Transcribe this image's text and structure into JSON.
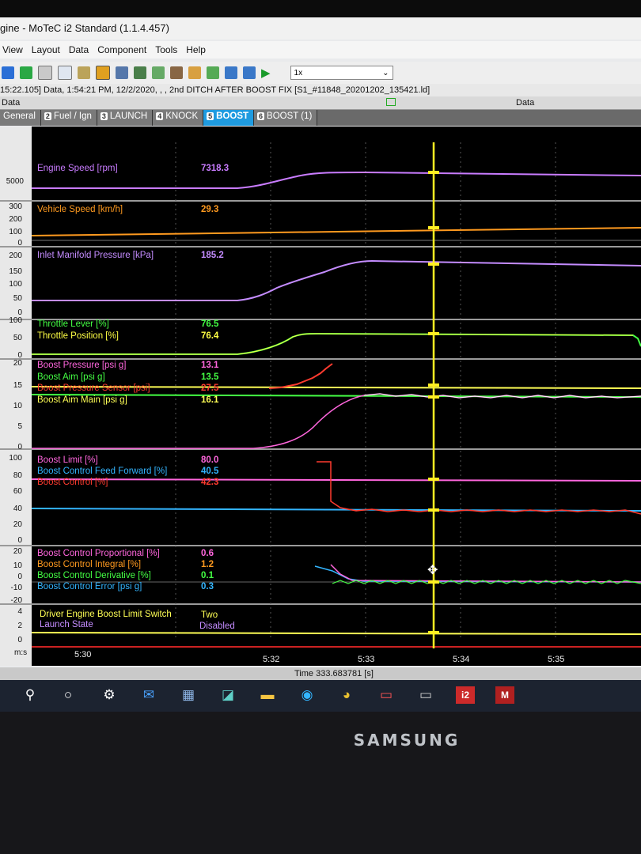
{
  "window": {
    "title": "gine - MoTeC i2 Standard (1.1.4.457)"
  },
  "menu": [
    "View",
    "Layout",
    "Data",
    "Component",
    "Tools",
    "Help"
  ],
  "toolbar": {
    "zoom_value": "1x"
  },
  "file_info": "15:22.105] Data, 1:54:21 PM, 12/2/2020, , , 2nd DITCH AFTER BOOST FIX [S1_#11848_20201202_135421.ld]",
  "data_bar": {
    "left": "Data",
    "right": "Data"
  },
  "tabs": [
    {
      "num": "",
      "label": "General"
    },
    {
      "num": "2",
      "label": "Fuel / Ign"
    },
    {
      "num": "3",
      "label": "LAUNCH"
    },
    {
      "num": "4",
      "label": "KNOCK"
    },
    {
      "num": "5",
      "label": "BOOST"
    },
    {
      "num": "6",
      "label": "BOOST (1)"
    }
  ],
  "panels": {
    "p1": {
      "ticks": [
        "5000"
      ],
      "channels": [
        {
          "name": "Engine Speed [rpm]",
          "value": "7318.3",
          "color": "#c97cff"
        }
      ]
    },
    "p2": {
      "ticks": [
        "300",
        "200",
        "100",
        "0"
      ],
      "channels": [
        {
          "name": "Vehicle Speed [km/h]",
          "value": "29.3",
          "color": "#ff9a1f"
        }
      ]
    },
    "p3": {
      "ticks": [
        "200",
        "150",
        "100",
        "50",
        "0"
      ],
      "channels": [
        {
          "name": "Inlet Manifold Pressure [kPa]",
          "value": "185.2",
          "color": "#c48cff"
        }
      ]
    },
    "p4": {
      "ticks": [
        "100",
        "50",
        "0"
      ],
      "channels": [
        {
          "name": "Throttle Lever [%]",
          "value": "76.5",
          "color": "#44ff44"
        },
        {
          "name": "Throttle Position [%]",
          "value": "76.4",
          "color": "#ffff44"
        }
      ]
    },
    "p5": {
      "ticks": [
        "20",
        "15",
        "10",
        "5",
        "0"
      ],
      "channels": [
        {
          "name": "Boost Pressure [psi g]",
          "value": "13.1",
          "color": "#ff66dd"
        },
        {
          "name": "Boost Aim [psi g]",
          "value": "13.5",
          "color": "#44ff44"
        },
        {
          "name": "Boost Pressure Sensor [psi]",
          "value": "27.5",
          "color": "#ff3b2f"
        },
        {
          "name": "Boost Aim Main [psi g]",
          "value": "16.1",
          "color": "#ffff55"
        }
      ]
    },
    "p6": {
      "ticks": [
        "100",
        "80",
        "60",
        "40",
        "20",
        "0"
      ],
      "channels": [
        {
          "name": "Boost Limit [%]",
          "value": "80.0",
          "color": "#ff66dd"
        },
        {
          "name": "Boost Control Feed Forward [%]",
          "value": "40.5",
          "color": "#33b5ff"
        },
        {
          "name": "Boost Control [%]",
          "value": "42.3",
          "color": "#ff3b2f"
        }
      ]
    },
    "p7": {
      "ticks": [
        "20",
        "10",
        "0",
        "-10",
        "-20"
      ],
      "channels": [
        {
          "name": "Boost Control Proportional [%]",
          "value": "0.6",
          "color": "#ff66dd"
        },
        {
          "name": "Boost Control Integral [%]",
          "value": "1.2",
          "color": "#ff9a1f"
        },
        {
          "name": "Boost Control Derivative [%]",
          "value": "0.1",
          "color": "#44ff44"
        },
        {
          "name": "Boost Control Error [psi g]",
          "value": "0.3",
          "color": "#33b5ff"
        }
      ]
    },
    "p8": {
      "ticks": [
        "4",
        "2",
        "0"
      ],
      "channels": [
        {
          "name": "Driver Engine Boost Limit Switch",
          "value": "Two",
          "color": "#ffff55"
        },
        {
          "name": "Launch State",
          "value": "Disabled",
          "color": "#c48cff"
        }
      ]
    }
  },
  "x_axis": {
    "unit": "m:s",
    "ticks": [
      "5:30",
      "5:32",
      "5:33",
      "5:34",
      "5:35"
    ]
  },
  "cursor_time_label": "Time  333.683781 [s]",
  "taskbar_badges": {
    "i2": "i2",
    "motec": "M"
  },
  "brand": "SAMSUNG",
  "colors": {
    "tab_active": "#1f9be0",
    "cursor": "#ffee22",
    "background": "#000000"
  }
}
